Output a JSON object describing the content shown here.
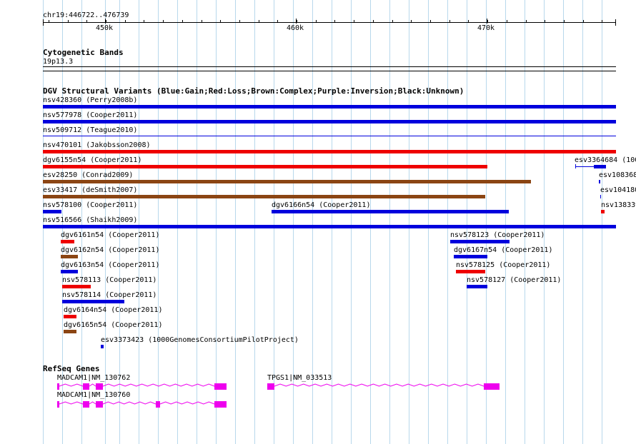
{
  "ruler": {
    "position_label": "chr19:446722..476739",
    "ticks": [
      "450k",
      "460k",
      "470k"
    ]
  },
  "cytogenetic_bands": {
    "title": "Cytogenetic Bands",
    "band": "19p13.3"
  },
  "dgv": {
    "title": "DGV Structural Variants (Blue:Gain;Red:Loss;Brown:Complex;Purple:Inversion;Black:Unknown)",
    "colors": {
      "gain": "#0000dd",
      "loss": "#ee0000",
      "complex": "#8b4513",
      "unknown": "#000000"
    },
    "features": [
      {
        "label": "nsv428360 (Perry2008b)",
        "type": "gain"
      },
      {
        "label": "nsv577978 (Cooper2011)",
        "type": "gain"
      },
      {
        "label": "nsv509712 (Teague2010)",
        "type": "gain"
      },
      {
        "label": "nsv470101 (Jakobsson2008)",
        "type": "loss"
      },
      {
        "label": "dgv6155n54 (Cooper2011)",
        "type": "loss"
      },
      {
        "label": "esv3364684 (100",
        "type": "gain"
      },
      {
        "label": "esv28250 (Conrad2009)",
        "type": "complex"
      },
      {
        "label": "esv108368",
        "type": "gain"
      },
      {
        "label": "esv33417 (deSmith2007)",
        "type": "complex"
      },
      {
        "label": "esv104180",
        "type": "gain"
      },
      {
        "label": "nsv578100 (Cooper2011)",
        "type": "gain"
      },
      {
        "label": "dgv6166n54 (Cooper2011)",
        "type": "gain"
      },
      {
        "label": "nsv138339",
        "type": "loss"
      },
      {
        "label": "nsv516566 (Shaikh2009)",
        "type": "gain"
      },
      {
        "label": "dgv6161n54 (Cooper2011)",
        "type": "loss"
      },
      {
        "label": "nsv578123 (Cooper2011)",
        "type": "gain"
      },
      {
        "label": "dgv6162n54 (Cooper2011)",
        "type": "complex"
      },
      {
        "label": "dgv6167n54 (Cooper2011)",
        "type": "gain"
      },
      {
        "label": "dgv6163n54 (Cooper2011)",
        "type": "gain"
      },
      {
        "label": "nsv578125 (Cooper2011)",
        "type": "loss"
      },
      {
        "label": "nsv578113 (Cooper2011)",
        "type": "loss"
      },
      {
        "label": "nsv578127 (Cooper2011)",
        "type": "gain"
      },
      {
        "label": "nsv578114 (Cooper2011)",
        "type": "gain"
      },
      {
        "label": "dgv6164n54 (Cooper2011)",
        "type": "loss"
      },
      {
        "label": "dgv6165n54 (Cooper2011)",
        "type": "complex"
      },
      {
        "label": "esv3373423 (1000GenomesConsortiumPilotProject)",
        "type": "gain"
      }
    ]
  },
  "refseq": {
    "title": "RefSeq Genes",
    "color": "#ee00ee",
    "genes": [
      {
        "label": "MADCAM1|NM_130762"
      },
      {
        "label": "TPGS1|NM_033513"
      },
      {
        "label": "MADCAM1|NM_130760"
      }
    ]
  }
}
